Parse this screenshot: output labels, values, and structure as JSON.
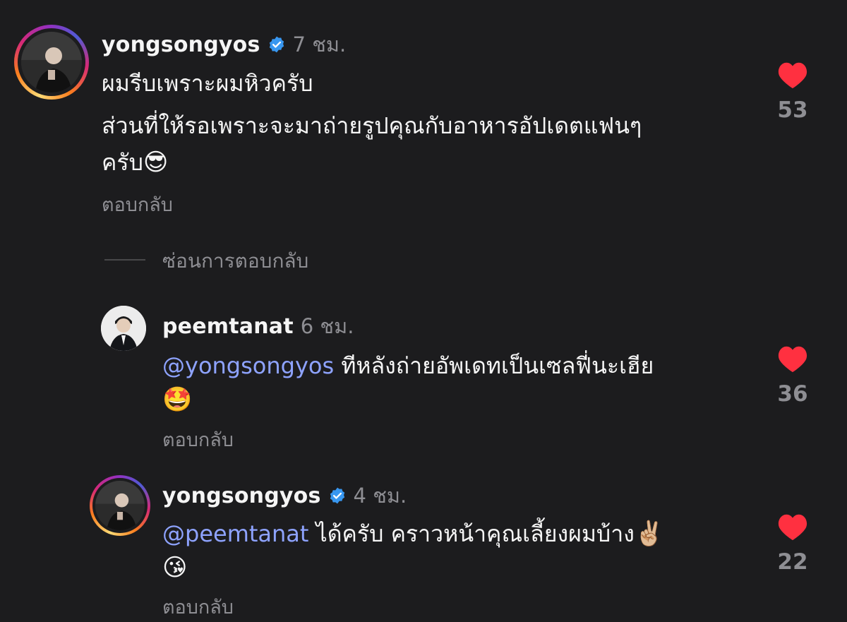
{
  "comments": [
    {
      "username": "yongsongyos",
      "verified": true,
      "time": "7 ชม.",
      "lines": [
        {
          "mention": "",
          "text": "ผมรีบเพราะผมหิวครับ",
          "emoji": ""
        },
        {
          "mention": "",
          "text": "ส่วนที่ให้รอเพราะจะมาถ่ายรูปคุณกับอาหารอัปเดตแฟนๆ",
          "emoji": ""
        },
        {
          "mention": "",
          "text": "ครับ",
          "emoji": "😎"
        }
      ],
      "reply_label": "ตอบกลับ",
      "likes": "53",
      "heart_icon": "heart-filled",
      "heart_color": "#ff3040"
    },
    {
      "username": "peemtanat",
      "verified": false,
      "time": "6 ชม.",
      "lines": [
        {
          "mention": "@yongsongyos",
          "text": " ทีหลังถ่ายอัพเดทเป็นเซลฟี่นะเฮีย",
          "emoji": ""
        },
        {
          "mention": "",
          "text": "",
          "emoji": "🤩"
        }
      ],
      "reply_label": "ตอบกลับ",
      "likes": "36",
      "heart_icon": "heart-filled",
      "heart_color": "#ff3040"
    },
    {
      "username": "yongsongyos",
      "verified": true,
      "time": "4 ชม.",
      "lines": [
        {
          "mention": "@peemtanat",
          "text": " ได้ครับ คราวหน้าคุณเลี้ยงผมบ้าง",
          "emoji": "✌🏼"
        },
        {
          "mention": "",
          "text": "",
          "emoji": "😘"
        }
      ],
      "reply_label": "ตอบกลับ",
      "likes": "22",
      "heart_icon": "heart-filled",
      "heart_color": "#ff3040"
    }
  ],
  "hide_replies_label": "ซ่อนการตอบกลับ",
  "colors": {
    "background": "#1c1c1e",
    "mention": "#8ea3ff",
    "secondary_text": "#8e8e93",
    "verified_badge": "#3897f0"
  }
}
